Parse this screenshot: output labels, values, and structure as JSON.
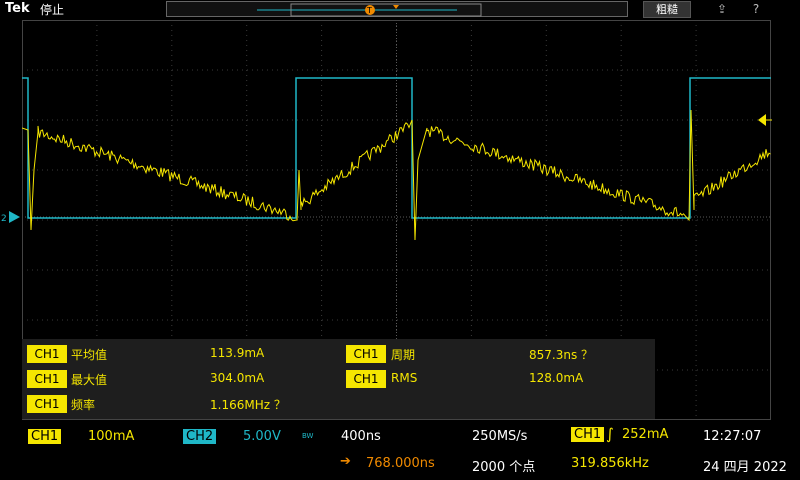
{
  "topbar": {
    "brand": "Tek",
    "state": "停止",
    "rough_button": "粗糙",
    "trigger_marker": "T"
  },
  "measurements": [
    {
      "channel": "CH1",
      "label": "平均值",
      "value": "113.9mA"
    },
    {
      "channel": "CH1",
      "label": "周期",
      "value": "857.3ns ？"
    },
    {
      "channel": "CH1",
      "label": "最大值",
      "value": "304.0mA"
    },
    {
      "channel": "CH1",
      "label": "RMS",
      "value": "128.0mA"
    },
    {
      "channel": "CH1",
      "label": "频率",
      "value": "1.166MHz ？"
    }
  ],
  "status": {
    "ch1_label": "CH1",
    "ch1_scale": "100mA",
    "ch2_label": "CH2",
    "ch2_scale": "5.00V",
    "bw_mark": "BW",
    "timebase": "400ns",
    "sample_rate": "250MS/s",
    "trig_channel": "CH1",
    "trig_level": "252mA",
    "time": "12:27:07",
    "delay": "768.000ns",
    "points": "2000 个点",
    "trig_freq": "319.856kHz",
    "date": "24 四月 2022"
  },
  "colors": {
    "ch1": "#f5e600",
    "ch2": "#1fb7c7",
    "trigger": "#f08a00"
  }
}
